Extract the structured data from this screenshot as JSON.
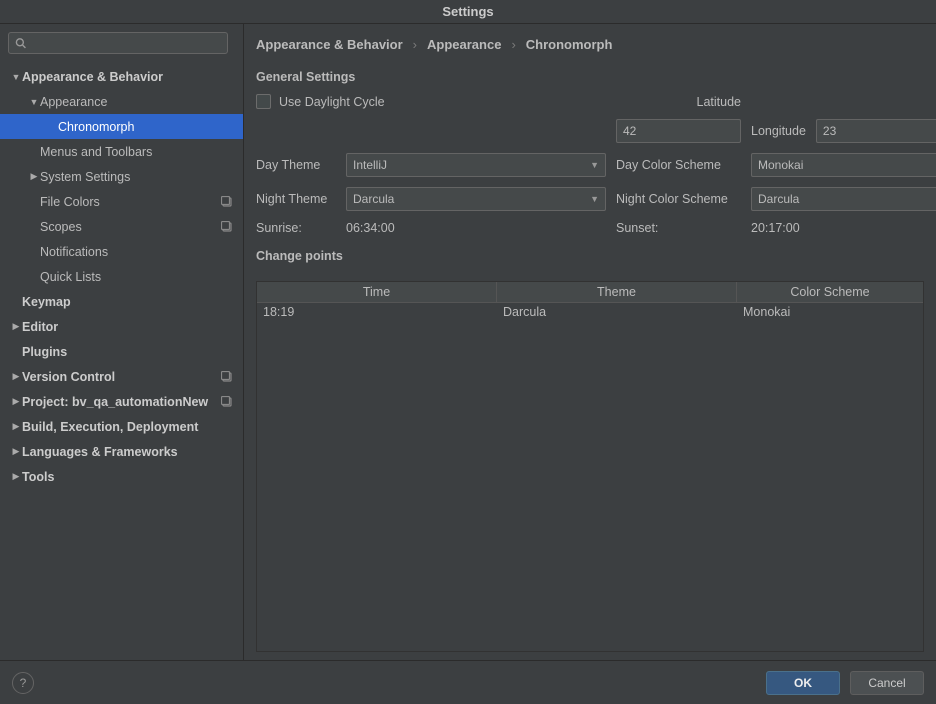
{
  "window": {
    "title": "Settings"
  },
  "breadcrumb": {
    "part1": "Appearance & Behavior",
    "part2": "Appearance",
    "part3": "Chronomorph"
  },
  "sidebar": {
    "search_placeholder": "",
    "items": [
      {
        "label": "Appearance & Behavior",
        "indent": 0,
        "arrow": "down",
        "bold": true
      },
      {
        "label": "Appearance",
        "indent": 1,
        "arrow": "down",
        "bold": false
      },
      {
        "label": "Chronomorph",
        "indent": 2,
        "arrow": "",
        "bold": false,
        "selected": true
      },
      {
        "label": "Menus and Toolbars",
        "indent": 1,
        "arrow": "",
        "bold": false
      },
      {
        "label": "System Settings",
        "indent": 1,
        "arrow": "right",
        "bold": false
      },
      {
        "label": "File Colors",
        "indent": 1,
        "arrow": "",
        "bold": false,
        "suffix": true
      },
      {
        "label": "Scopes",
        "indent": 1,
        "arrow": "",
        "bold": false,
        "suffix": true
      },
      {
        "label": "Notifications",
        "indent": 1,
        "arrow": "",
        "bold": false
      },
      {
        "label": "Quick Lists",
        "indent": 1,
        "arrow": "",
        "bold": false
      },
      {
        "label": "Keymap",
        "indent": 0,
        "arrow": "",
        "bold": true
      },
      {
        "label": "Editor",
        "indent": 0,
        "arrow": "right",
        "bold": true
      },
      {
        "label": "Plugins",
        "indent": 0,
        "arrow": "",
        "bold": true
      },
      {
        "label": "Version Control",
        "indent": 0,
        "arrow": "right",
        "bold": true,
        "suffix": true
      },
      {
        "label": "Project: bv_qa_automationNew",
        "indent": 0,
        "arrow": "right",
        "bold": true,
        "suffix": true
      },
      {
        "label": "Build, Execution, Deployment",
        "indent": 0,
        "arrow": "right",
        "bold": true
      },
      {
        "label": "Languages & Frameworks",
        "indent": 0,
        "arrow": "right",
        "bold": true
      },
      {
        "label": "Tools",
        "indent": 0,
        "arrow": "right",
        "bold": true
      }
    ]
  },
  "general": {
    "section_title": "General Settings",
    "daylight_label": "Use Daylight Cycle",
    "latitude_label": "Latitude",
    "latitude_value": "42",
    "longitude_label": "Longitude",
    "longitude_value": "23",
    "day_theme_label": "Day Theme",
    "day_theme_value": "IntelliJ",
    "day_color_label": "Day Color Scheme",
    "day_color_value": "Monokai",
    "night_theme_label": "Night Theme",
    "night_theme_value": "Darcula",
    "night_color_label": "Night Color Scheme",
    "night_color_value": "Darcula",
    "sunrise_label": "Sunrise:",
    "sunrise_value": "06:34:00",
    "sunset_label": "Sunset:",
    "sunset_value": "20:17:00"
  },
  "changepoints": {
    "section_title": "Change points",
    "headers": {
      "time": "Time",
      "theme": "Theme",
      "scheme": "Color Scheme"
    },
    "rows": [
      {
        "time": "18:19",
        "theme": "Darcula",
        "scheme": "Monokai"
      }
    ]
  },
  "footer": {
    "ok": "OK",
    "cancel": "Cancel"
  }
}
